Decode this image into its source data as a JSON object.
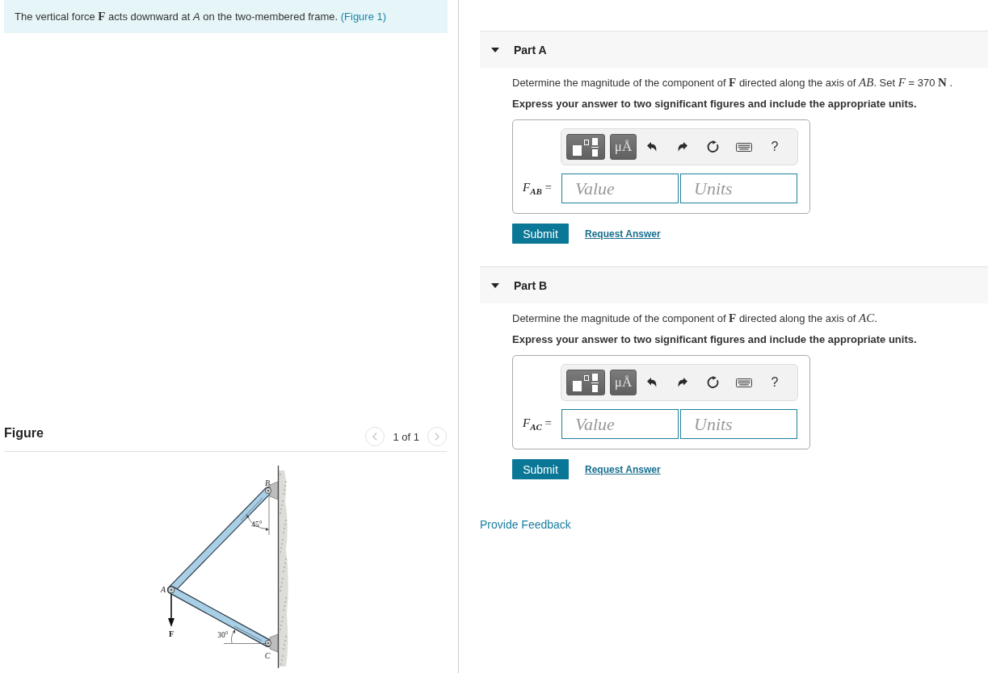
{
  "problem": {
    "text": "The vertical force **F** acts downward at *A* on the two-membered frame.",
    "figure_link": "(Figure 1)"
  },
  "figure": {
    "heading": "Figure",
    "pager": "1 of 1",
    "prev": {
      "disabled": true
    },
    "next": {
      "disabled": true
    },
    "diagram": {
      "label_b": "B",
      "angle_ab": "45°",
      "label_a": "A",
      "force": "F",
      "angle_ac": "30°",
      "label_c": "C"
    }
  },
  "parts": [
    {
      "title": "Part A",
      "expanded": true,
      "question": "Determine the magnitude of the component of **F** directed along the axis of *AB*. Set *F* = 370 **N** .",
      "instruction": "Express your answer to two significant figures and include the appropriate units.",
      "units_button": "μÅ",
      "help_button": "?",
      "answer_label": "*F*$_{AB}$ =",
      "value_placeholder": "Value",
      "units_placeholder": "Units",
      "submit": "Submit",
      "request_answer": "Request Answer"
    },
    {
      "title": "Part B",
      "expanded": true,
      "question": "Determine the magnitude of the component of **F** directed along the axis of *AC*.",
      "instruction": "Express your answer to two significant figures and include the appropriate units.",
      "units_button": "μÅ",
      "help_button": "?",
      "answer_label": "*F*$_{AC}$ =",
      "value_placeholder": "Value",
      "units_placeholder": "Units",
      "submit": "Submit",
      "request_answer": "Request Answer"
    }
  ],
  "feedback_link": "Provide Feedback"
}
